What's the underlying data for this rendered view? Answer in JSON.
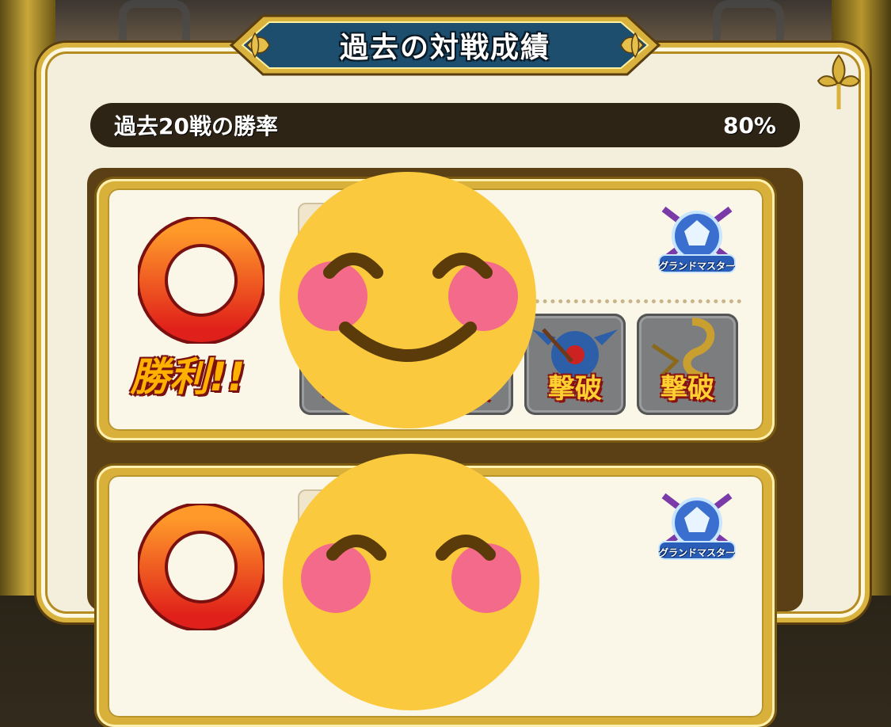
{
  "header": {
    "title": "過去の対戦成績"
  },
  "win_rate": {
    "label": "過去20戦の勝率",
    "value": "80%"
  },
  "records": [
    {
      "result": "勝利!!",
      "rank_badge": "グランドマスター",
      "monsters": [
        {
          "status": "撃破"
        },
        {
          "status": "撃破"
        },
        {
          "status": "撃破"
        },
        {
          "status": "撃破"
        }
      ]
    },
    {
      "rank_badge": "グランドマスター"
    }
  ],
  "colors": {
    "banner": "#1d4e6e",
    "gold": "#d8b23c",
    "panel": "#f4eedc",
    "win_ring": "#f03c1a",
    "rate_bar": "#2e2416"
  }
}
